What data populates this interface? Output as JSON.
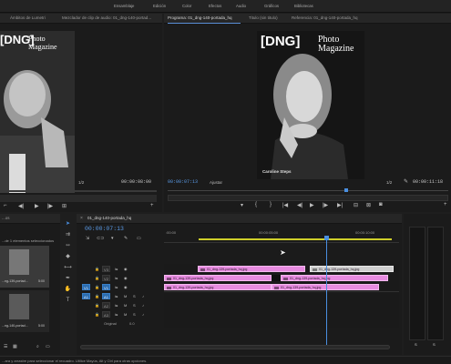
{
  "workspaces": [
    "Ensamblaje",
    "Edición",
    "Color",
    "Efectos",
    "Audio",
    "Gráficos",
    "Bibliotecas"
  ],
  "source_monitor": {
    "tabs": [
      "Ámbitos de Lumetri",
      "Mezclador de clip de audio: 01_dng-140-portad..."
    ],
    "timecode_end": "00:00:08:00",
    "zoom": "1/2",
    "cover_brand": "[DNG]",
    "cover_title_1": "Photo",
    "cover_title_2": "Magazine"
  },
  "program_monitor": {
    "tabs": [
      "Programa: 01_dng-140-portada_hq",
      "Titulo (sin titulo)",
      "Referencia: 01_dng-140-portada_hq"
    ],
    "timecode": "00:00:07:13",
    "fit": "Ajustar",
    "zoom": "1/2",
    "timecode_end": "00:00:11:18",
    "cover_brand": "[DNG]",
    "cover_title_1": "Photo",
    "cover_title_2": "Magazine",
    "cover_caption": "Caroline Steps"
  },
  "project": {
    "tab": "...os",
    "selection_text": "...de 1 elementos seleccionados",
    "items": [
      {
        "name": "...ng-139-portad...",
        "duration": "5:00"
      },
      {
        "name": "...ng-140-portad...",
        "duration": "5:00"
      }
    ]
  },
  "timeline": {
    "tab": "01_dng-140-portada_hq",
    "timecode": "00:00:07:13",
    "ruler_labels": [
      ":00:00",
      "00:00:05:00",
      "00:00:10:00"
    ],
    "tracks": {
      "v3": "V3",
      "v2": "V2",
      "v1": "V1",
      "a1": "A1",
      "a2": "A2",
      "a3": "A3",
      "source_v": "V1",
      "source_a": "A1",
      "original_label": "Original",
      "original_value": "0.0"
    },
    "clips": [
      {
        "label": "01_dng-139-portada_hq.jpg",
        "track": "v3"
      },
      {
        "label": "01_dng-139-portada_hq.jpg",
        "track": "v3"
      },
      {
        "label": "01_dng-139-portada_hq.jpg",
        "track": "v2"
      },
      {
        "label": "01_dng-139-portada_hq.jpg",
        "track": "v2"
      },
      {
        "label": "01_dng-139-portada_hq.jpg",
        "track": "v1"
      },
      {
        "label": "01_dng-139-portada_hq.jpg",
        "track": "v1"
      }
    ]
  },
  "status_bar": "...ara y arrastre para seleccionar el recuadro. Utilice Mayús, Alt y Ctrl para otras opciones.",
  "meters": {
    "label_left": "S",
    "label_right": "S"
  },
  "icons": {
    "selection_tool": "arrow-icon",
    "play": "play-icon",
    "step_back": "step-back-icon",
    "step_forward": "step-forward-icon",
    "mark_in": "mark-in-icon",
    "mark_out": "mark-out-icon",
    "wrench": "wrench-icon",
    "add": "plus-icon"
  },
  "colors": {
    "accent": "#5a9ae6",
    "clip_pink": "#e78be0",
    "clip_grey": "#cfcfcf",
    "work_area": "#cfcf2a"
  }
}
